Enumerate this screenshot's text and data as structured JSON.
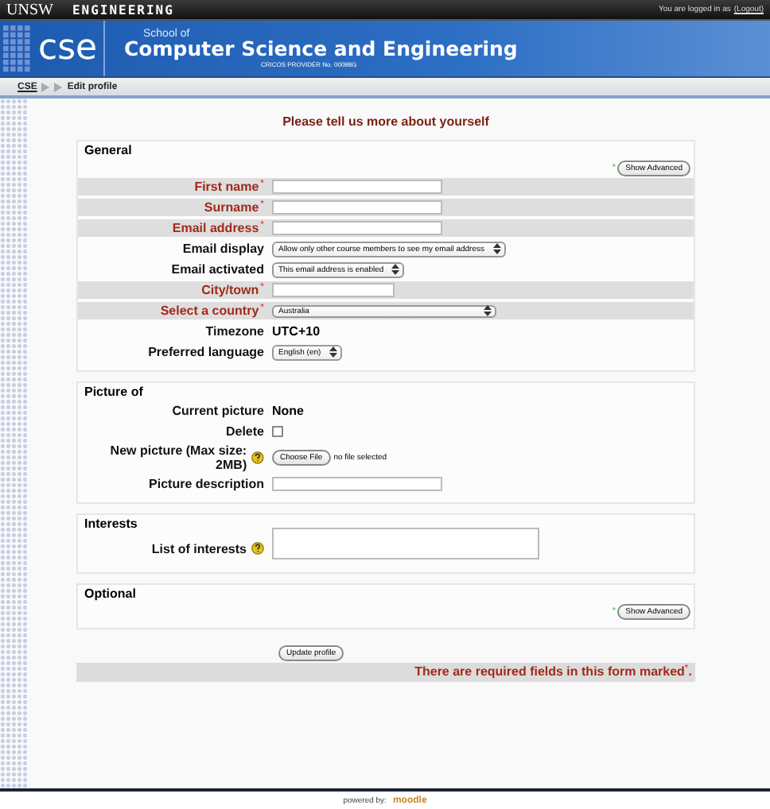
{
  "top_bar": {
    "university": "UNSW",
    "faculty": "ENGINEERING",
    "login_text": "You are logged in as",
    "logout_link": "(Logout)"
  },
  "banner": {
    "logo": "cse",
    "subtitle": "School of",
    "title": "Computer Science and Engineering",
    "provider": "CRICOS PROVIDER No. 00098G"
  },
  "breadcrumb": [
    {
      "label": "CSE",
      "link": true
    },
    {
      "label": "Edit profile",
      "link": false
    }
  ],
  "heading": "Please tell us more about yourself",
  "sections": [
    {
      "legend": "General",
      "advanced_mark": "*",
      "advanced_button": "Show Advanced",
      "fields": [
        {
          "kind": "text",
          "label": "First name",
          "required": true,
          "mark": "*"
        },
        {
          "kind": "text",
          "label": "Surname",
          "required": true,
          "mark": "*"
        },
        {
          "kind": "text",
          "label": "Email address",
          "required": true,
          "mark": "*"
        },
        {
          "kind": "select",
          "label": "Email display",
          "required": false,
          "value": "Allow only other course members to see my email address"
        },
        {
          "kind": "select",
          "label": "Email activated",
          "required": false,
          "value": "This email address is enabled"
        },
        {
          "kind": "short",
          "label": "City/town",
          "required": true,
          "mark": "*"
        },
        {
          "kind": "select",
          "label": "Select a country",
          "required": true,
          "mark": "*",
          "value": "Australia",
          "wide": true
        },
        {
          "kind": "static",
          "label": "Timezone",
          "required": false,
          "value": "UTC+10"
        },
        {
          "kind": "select",
          "label": "Preferred language",
          "required": false,
          "value": "English (en)"
        }
      ]
    },
    {
      "legend": "Picture of",
      "fields": [
        {
          "kind": "static",
          "label": "Current picture",
          "required": false,
          "value": "None"
        },
        {
          "kind": "checkbox",
          "label": "Delete",
          "required": false,
          "checked": false
        },
        {
          "kind": "file",
          "label": "New picture (Max size: 2MB)",
          "required": false,
          "help": true,
          "button": "Choose File",
          "value": "no file selected"
        },
        {
          "kind": "text",
          "label": "Picture description",
          "required": false
        }
      ]
    },
    {
      "legend": "Interests",
      "fields": [
        {
          "kind": "textarea",
          "label": "List of interests",
          "required": false,
          "help": true
        }
      ]
    },
    {
      "legend": "Optional",
      "advanced_mark": "*",
      "advanced_button": "Show Advanced"
    }
  ],
  "submit_button": "Update profile",
  "required_note": {
    "text": "There are required fields in this form marked",
    "mark": "*",
    "end": "."
  },
  "footer": {
    "powered_by": "powered by:",
    "logo": "moodle"
  }
}
